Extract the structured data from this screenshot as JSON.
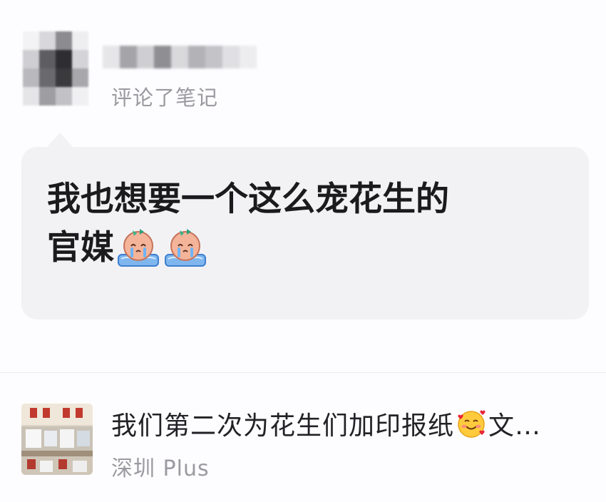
{
  "colors": {
    "background": "#fdfdff",
    "bubble": "#f2f2f5",
    "text_primary": "#1b1b1d",
    "text_secondary": "#9a9aa0",
    "divider": "#ececf0"
  },
  "notification": {
    "user_name_blurred": true,
    "action_text": "评论了笔记"
  },
  "comment": {
    "text_line1": "我也想要一个这么宠花生的",
    "text_line2": "官媒",
    "emojis": [
      "crying-peanut-icon",
      "crying-peanut-icon"
    ]
  },
  "note": {
    "title_text": "我们第二次为花生们加印报纸",
    "title_emoji": "smiling-face-with-hearts-icon",
    "title_suffix": "文…",
    "author": "深圳 Plus"
  }
}
